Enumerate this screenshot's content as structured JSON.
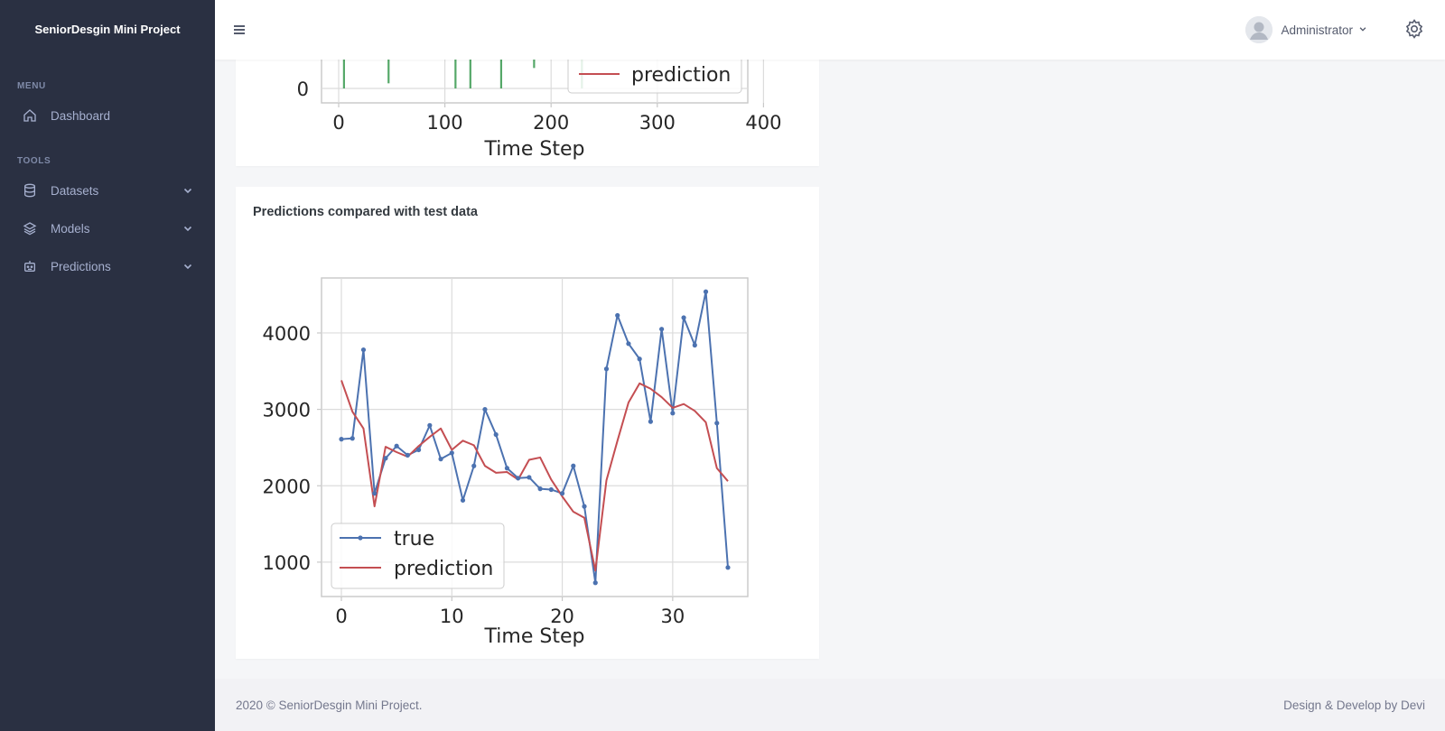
{
  "brand": {
    "title": "SeniorDesgin Mini Project"
  },
  "sidebar": {
    "menu_title": "MENU",
    "tools_title": "TOOLS",
    "items": [
      {
        "label": "Dashboard",
        "icon": "home-icon"
      },
      {
        "label": "Datasets",
        "icon": "database-icon"
      },
      {
        "label": "Models",
        "icon": "layers-icon"
      },
      {
        "label": "Predictions",
        "icon": "robot-icon"
      }
    ]
  },
  "header": {
    "user_name": "Administrator"
  },
  "cards": {
    "top_chart_legend": "prediction",
    "top_chart_xlabel": "Time Step",
    "bottom_title": "Predictions compared with test data"
  },
  "footer": {
    "left": "2020 © SeniorDesgin Mini Project.",
    "right": "Design & Develop by Devi"
  },
  "colors": {
    "sidebar": "#2a3042",
    "true_series": "#4c72b0",
    "prediction_series": "#c44e52",
    "bar_series": "#55a868"
  },
  "chart_data": [
    {
      "type": "bar",
      "partial": true,
      "x_ticks": [
        0,
        100,
        200,
        300,
        400
      ],
      "y_ticks_visible": [
        0
      ],
      "xlabel": "Time Step",
      "legend": [
        "prediction"
      ],
      "bars": [
        {
          "x": 5,
          "value": 0.3
        },
        {
          "x": 47,
          "value": 0.25
        },
        {
          "x": 110,
          "value": 0.3
        },
        {
          "x": 124,
          "value": 0.3
        },
        {
          "x": 153,
          "value": 0.3
        },
        {
          "x": 184,
          "value": 0.1
        },
        {
          "x": 229,
          "value": 0.3
        }
      ]
    },
    {
      "type": "line",
      "title": "Predictions compared with test data",
      "xlabel": "Time Step",
      "xlim": [
        -1.8,
        36.8
      ],
      "ylim": [
        550,
        4720
      ],
      "x_ticks": [
        0,
        10,
        20,
        30
      ],
      "y_ticks": [
        1000,
        2000,
        3000,
        4000
      ],
      "grid": true,
      "legend_position": "lower-left",
      "series": [
        {
          "name": "true",
          "marker": true,
          "values": [
            2610,
            2620,
            3780,
            1900,
            2360,
            2520,
            2400,
            2470,
            2790,
            2350,
            2430,
            1810,
            2260,
            3000,
            2670,
            2230,
            2100,
            2110,
            1960,
            1950,
            1900,
            2260,
            1730,
            730,
            3530,
            4230,
            3860,
            3660,
            2840,
            4050,
            2950,
            4200,
            3840,
            4540,
            2820,
            930
          ]
        },
        {
          "name": "prediction",
          "marker": false,
          "values": [
            3380,
            2970,
            2750,
            1730,
            2510,
            2440,
            2380,
            2520,
            2640,
            2750,
            2470,
            2590,
            2530,
            2260,
            2170,
            2180,
            2080,
            2340,
            2370,
            2080,
            1860,
            1660,
            1580,
            890,
            2070,
            2590,
            3090,
            3340,
            3270,
            3160,
            3020,
            3070,
            2980,
            2830,
            2230,
            2060
          ]
        }
      ]
    }
  ]
}
